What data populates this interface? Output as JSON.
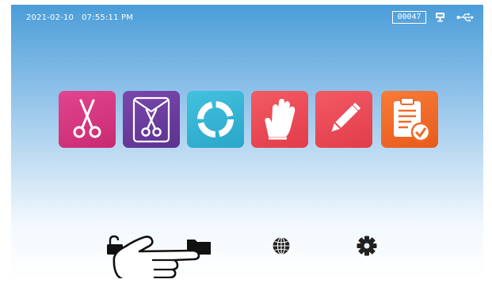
{
  "status_bar": {
    "date": "2021-02-10",
    "time": "07:55:11 PM",
    "counter": "00047",
    "icons": [
      "monitor-icon",
      "usb-icon"
    ]
  },
  "menu_tiles": [
    {
      "icon": "scissors-icon",
      "color": "#d83a86"
    },
    {
      "icon": "scissors-pouch-icon",
      "color": "#6b3fa0"
    },
    {
      "icon": "cycle-ring-icon",
      "color": "#35b4d4"
    },
    {
      "icon": "glove-icon",
      "color": "#ee4a56"
    },
    {
      "icon": "pencil-icon",
      "color": "#ee4a56"
    },
    {
      "icon": "clipboard-check-icon",
      "color": "#f06a28"
    }
  ],
  "bottom_bar": {
    "icons": [
      "unlock-icon",
      "folder-icon",
      "globe-icon",
      "gear-icon"
    ]
  },
  "overlay": {
    "icon": "pointing-hand-icon"
  }
}
